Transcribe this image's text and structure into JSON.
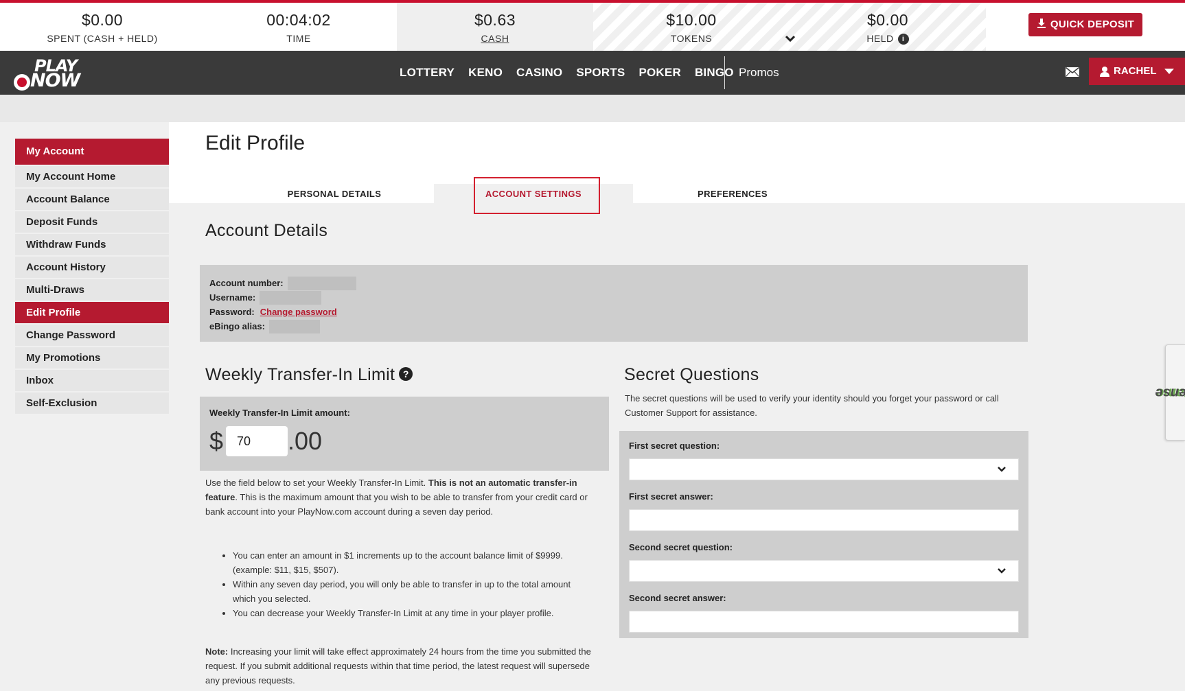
{
  "balances": {
    "spent": {
      "value": "$0.00",
      "label": "SPENT (CASH + HELD)"
    },
    "time": {
      "value": "00:04:02",
      "label": "TIME"
    },
    "cash": {
      "value": "$0.63",
      "label": "CASH"
    },
    "tokens": {
      "value": "$10.00",
      "label": "TOKENS"
    },
    "held": {
      "value": "$0.00",
      "label": "HELD"
    }
  },
  "quick_deposit_label": "QUICK DEPOSIT",
  "logo": {
    "line1": "PLAY",
    "line2": "NOW"
  },
  "nav": {
    "items": [
      "LOTTERY",
      "KENO",
      "CASINO",
      "SPORTS",
      "POKER",
      "BINGO"
    ],
    "promos": "Promos",
    "user_name": "RACHEL"
  },
  "sidebar": {
    "heading": "My Account",
    "items": [
      "My Account Home",
      "Account Balance",
      "Deposit Funds",
      "Withdraw Funds",
      "Account History",
      "Multi-Draws",
      "Edit Profile",
      "Change Password",
      "My Promotions",
      "Inbox",
      "Self-Exclusion"
    ],
    "active": "Edit Profile"
  },
  "page_title": "Edit Profile",
  "tabs": [
    "PERSONAL DETAILS",
    "ACCOUNT SETTINGS",
    "PREFERENCES"
  ],
  "active_tab": "ACCOUNT SETTINGS",
  "account_details": {
    "title": "Account Details",
    "account_number_label": "Account number:",
    "username_label": "Username:",
    "password_label": "Password:",
    "change_password_link": "Change password",
    "ebingo_label": "eBingo alias:"
  },
  "transfer_limit": {
    "title": "Weekly Transfer-In Limit",
    "amount_label": "Weekly Transfer-In Limit amount:",
    "currency": "$",
    "amount": "70",
    "cents": ".00",
    "desc_part1": "Use the field below to set your Weekly Transfer-In Limit. ",
    "desc_bold": "This is not an automatic transfer-in feature",
    "desc_part2": ". This is the maximum amount that you wish to be able to transfer from your credit card or bank account into your PlayNow.com account during a seven day period.",
    "bullets": [
      "You can enter an amount in $1 increments up to the account balance limit of $9999. (example: $11, $15, $507).",
      "Within any seven day period, you will only be able to transfer in up to the total amount which you selected.",
      "You can decrease your Weekly Transfer-In Limit at any time in your player profile."
    ],
    "note_label": "Note:",
    "note_text": " Increasing your limit will take effect approximately 24 hours from the time you submitted the request. If you submit additional requests within that time period, the latest request will supersede any previous requests."
  },
  "secret_questions": {
    "title": "Secret Questions",
    "description": "The secret questions will be used to verify your identity should you forget your password or call Customer Support for assistance.",
    "first_question_label": "First secret question:",
    "first_answer_label": "First secret answer:",
    "second_question_label": "Second secret question:",
    "second_answer_label": "Second secret answer:"
  },
  "gamesense": {
    "part1": "Game",
    "part2": "Sense"
  },
  "colors": {
    "brand_red": "#b51a30",
    "nav_dark": "#3a3a3a",
    "highlight_red": "#d3202f"
  }
}
